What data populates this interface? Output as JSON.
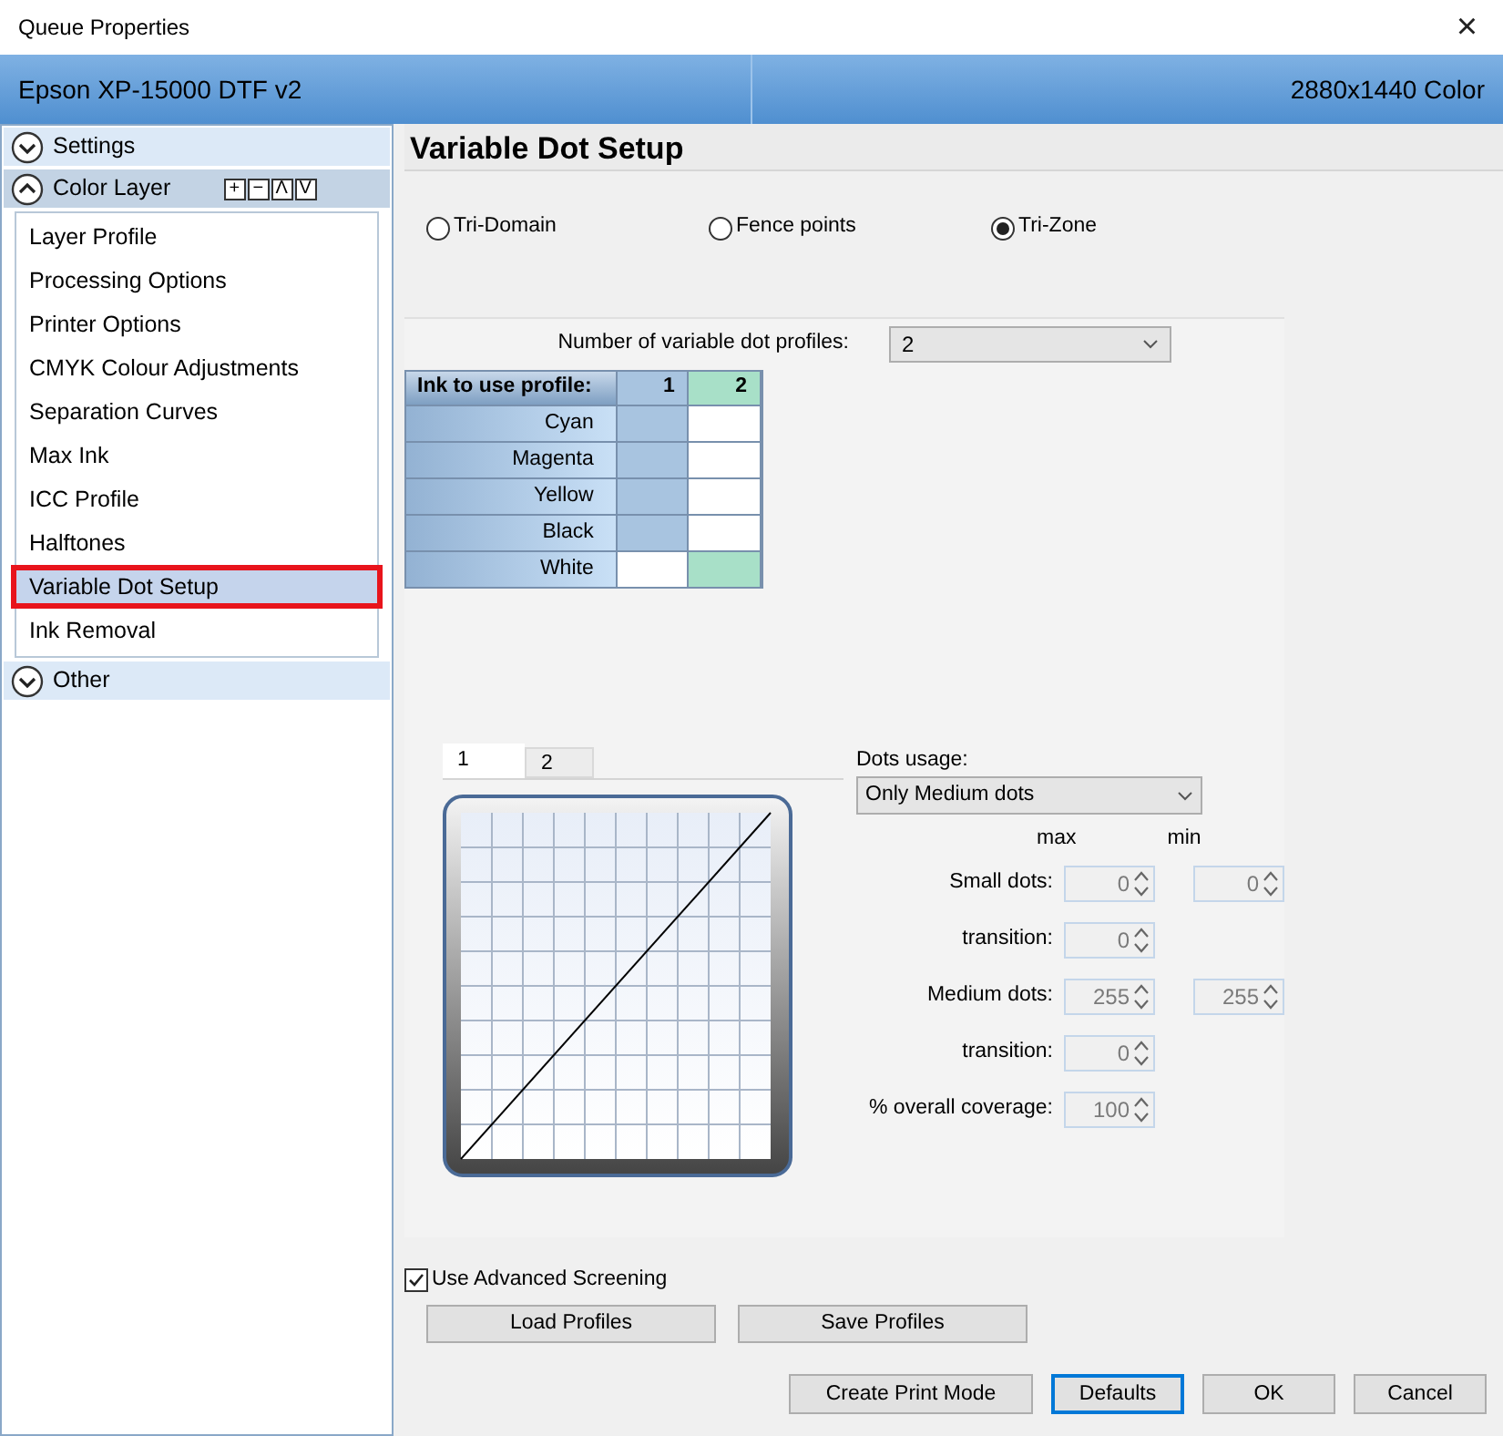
{
  "window": {
    "title": "Queue Properties",
    "close": "×"
  },
  "header": {
    "printer": "Epson XP-15000 DTF v2",
    "resolution": "2880x1440 Color"
  },
  "sidebar": {
    "sections": [
      {
        "label": "Settings",
        "expanded": false
      },
      {
        "label": "Color Layer",
        "expanded": true,
        "tools": [
          "+",
          "−",
          "Λ",
          "V"
        ],
        "items": [
          {
            "label": "Layer Profile",
            "selected": false
          },
          {
            "label": "Processing Options",
            "selected": false
          },
          {
            "label": "Printer Options",
            "selected": false
          },
          {
            "label": "CMYK Colour Adjustments",
            "selected": false
          },
          {
            "label": "Separation Curves",
            "selected": false
          },
          {
            "label": "Max Ink",
            "selected": false
          },
          {
            "label": "ICC Profile",
            "selected": false
          },
          {
            "label": "Halftones",
            "selected": false
          },
          {
            "label": "Variable Dot Setup",
            "selected": true
          },
          {
            "label": "Ink Removal",
            "selected": false
          }
        ]
      },
      {
        "label": "Other",
        "expanded": false
      }
    ]
  },
  "page_title": "Variable Dot Setup",
  "modes": [
    {
      "label": "Tri-Domain",
      "selected": false
    },
    {
      "label": "Fence points",
      "selected": false
    },
    {
      "label": "Tri-Zone",
      "selected": true
    }
  ],
  "profile_count": {
    "label": "Number of variable dot profiles:",
    "value": "2"
  },
  "ink_table": {
    "header": "Ink to use profile:",
    "columns": [
      {
        "label": "1",
        "color": "#a8c4e0"
      },
      {
        "label": "2",
        "color": "#a8e0c8"
      }
    ],
    "rows": [
      {
        "ink": "Cyan",
        "cells": [
          {
            "selected": true
          },
          {
            "selected": false
          }
        ]
      },
      {
        "ink": "Magenta",
        "cells": [
          {
            "selected": true
          },
          {
            "selected": false
          }
        ]
      },
      {
        "ink": "Yellow",
        "cells": [
          {
            "selected": true
          },
          {
            "selected": false
          }
        ]
      },
      {
        "ink": "Black",
        "cells": [
          {
            "selected": true
          },
          {
            "selected": false
          }
        ]
      },
      {
        "ink": "White",
        "cells": [
          {
            "selected": false
          },
          {
            "selected": true
          }
        ]
      }
    ]
  },
  "curve_tabs": [
    {
      "label": "1",
      "selected": true
    },
    {
      "label": "2",
      "selected": false
    }
  ],
  "dots_usage": {
    "label": "Dots usage:",
    "value": "Only Medium dots"
  },
  "column_labels": [
    "max",
    "min"
  ],
  "spinner_rows": [
    {
      "label": "Small dots:",
      "fields": [
        {
          "value": "0",
          "disabled": true
        },
        {
          "value": "0",
          "disabled": true
        }
      ]
    },
    {
      "label": "transition:",
      "fields": [
        {
          "value": "0",
          "disabled": true
        }
      ]
    },
    {
      "label": "Medium dots:",
      "fields": [
        {
          "value": "255",
          "disabled": true
        },
        {
          "value": "255",
          "disabled": true
        }
      ]
    },
    {
      "label": "transition:",
      "fields": [
        {
          "value": "0",
          "disabled": true
        }
      ]
    },
    {
      "label": "% overall coverage:",
      "fields": [
        {
          "value": "100",
          "disabled": true
        }
      ]
    }
  ],
  "advanced_screening": {
    "label": "Use Advanced Screening",
    "checked": true
  },
  "profile_buttons": [
    "Load Profiles",
    "Save Profiles"
  ],
  "footer_buttons": [
    {
      "label": "Create Print Mode",
      "focused": false
    },
    {
      "label": "Defaults",
      "focused": true
    },
    {
      "label": "OK",
      "focused": false
    },
    {
      "label": "Cancel",
      "focused": false
    }
  ]
}
